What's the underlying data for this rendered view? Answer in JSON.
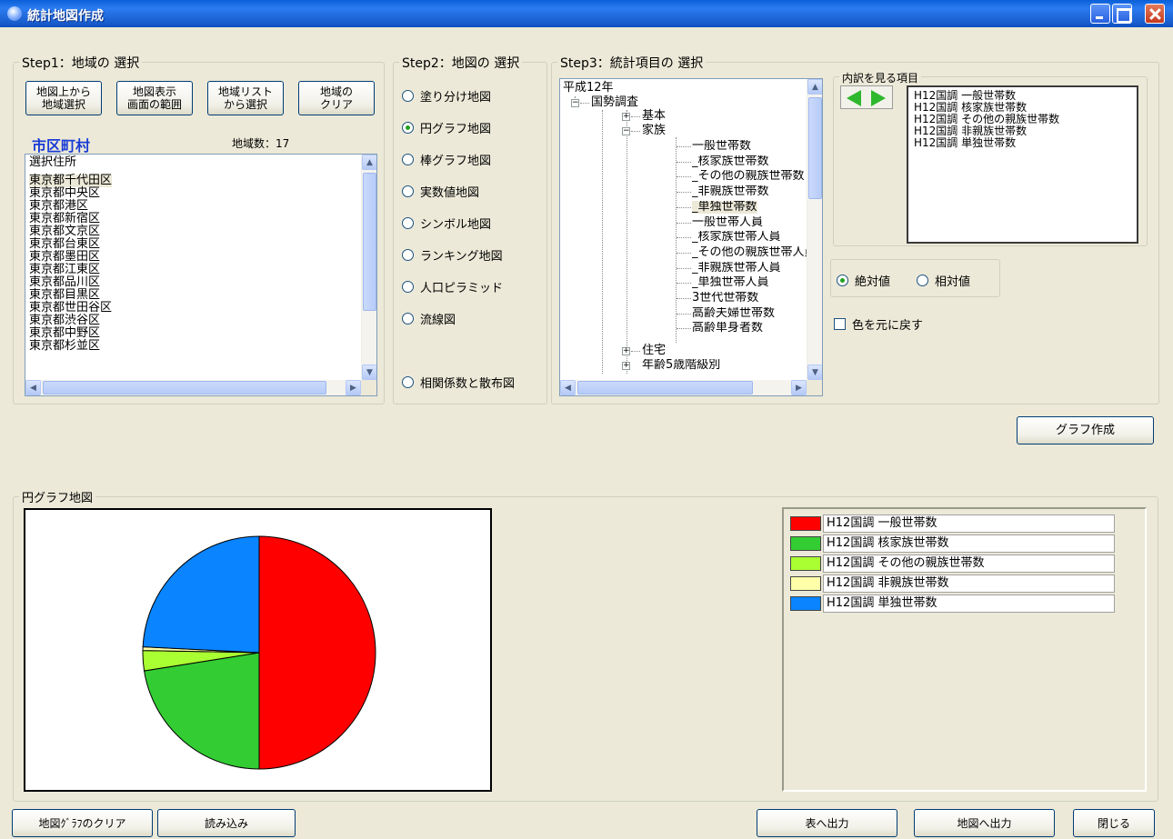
{
  "window": {
    "title": "統計地図作成"
  },
  "step1": {
    "label": "Step1：地域の 選択",
    "buttons": [
      "地図上から\n地域選択",
      "地図表示\n画面の範囲",
      "地域リスト\nから選択",
      "地域の\nクリア"
    ],
    "level": "市区町村",
    "count_label": "地域数：17",
    "list_header": "選択住所",
    "items": [
      "東京都千代田区",
      "東京都中央区",
      "東京都港区",
      "東京都新宿区",
      "東京都文京区",
      "東京都台東区",
      "東京都墨田区",
      "東京都江東区",
      "東京都品川区",
      "東京都目黒区",
      "東京都世田谷区",
      "東京都渋谷区",
      "東京都中野区",
      "東京都杉並区"
    ]
  },
  "step2": {
    "label": "Step2：地図の 選択",
    "options": [
      "塗り分け地図",
      "円グラフ地図",
      "棒グラフ地図",
      "実数値地図",
      "シンボル地図",
      "ランキング地図",
      "人口ピラミッド",
      "流線図",
      "相関係数と散布図"
    ],
    "selected_index": 1
  },
  "step3": {
    "label": "Step3：統計項目の 選択",
    "tree": {
      "root": "平成12年",
      "survey": "国勢調査",
      "basic": "基本",
      "family": "家族",
      "family_items": [
        "一般世帯数",
        "_核家族世帯数",
        "_その他の親族世帯数",
        "_非親族世帯数",
        "_単独世帯数",
        "一般世帯人員",
        "_核家族世帯人員",
        "_その他の親族世帯人員",
        "_非親族世帯人員",
        "_単独世帯人員",
        "3世代世帯数",
        "高齢夫婦世帯数",
        "高齢単身者数"
      ],
      "housing": "住宅",
      "age": "年齢5歳階級別"
    },
    "breakdown_label": "内訳を見る項目",
    "breakdown_items": [
      "H12国調 一般世帯数",
      "H12国調 核家族世帯数",
      "H12国調 その他の親族世帯数",
      "H12国調 非親族世帯数",
      "H12国調 単独世帯数"
    ],
    "value_mode": {
      "absolute": "絶対値",
      "relative": "相対値",
      "selected": "absolute"
    },
    "reset_color": "色を元に戻す"
  },
  "create_button": "グラフ作成",
  "pie_panel": {
    "label": "円グラフ地図",
    "legend": [
      {
        "label": "H12国調 一般世帯数",
        "color": "#ff0000"
      },
      {
        "label": "H12国調 核家族世帯数",
        "color": "#33cc33"
      },
      {
        "label": "H12国調 その他の親族世帯数",
        "color": "#aaff33"
      },
      {
        "label": "H12国調 非親族世帯数",
        "color": "#ffffaa"
      },
      {
        "label": "H12国調 単独世帯数",
        "color": "#0a84ff"
      }
    ]
  },
  "chart_data": {
    "type": "pie",
    "categories": [
      "H12国調 一般世帯数",
      "H12国調 核家族世帯数",
      "H12国調 その他の親族世帯数",
      "H12国調 非親族世帯数",
      "H12国調 単独世帯数"
    ],
    "values": [
      50,
      22.5,
      2.8,
      0.5,
      24.2
    ],
    "colors": [
      "#ff0000",
      "#33cc33",
      "#aaff33",
      "#ffffaa",
      "#0a84ff"
    ]
  },
  "bottom_buttons": {
    "clear_graph": "地図ｸﾞﾗﾌのクリア",
    "load": "読み込み",
    "export_table": "表へ出力",
    "export_map": "地図へ出力",
    "close": "閉じる"
  }
}
